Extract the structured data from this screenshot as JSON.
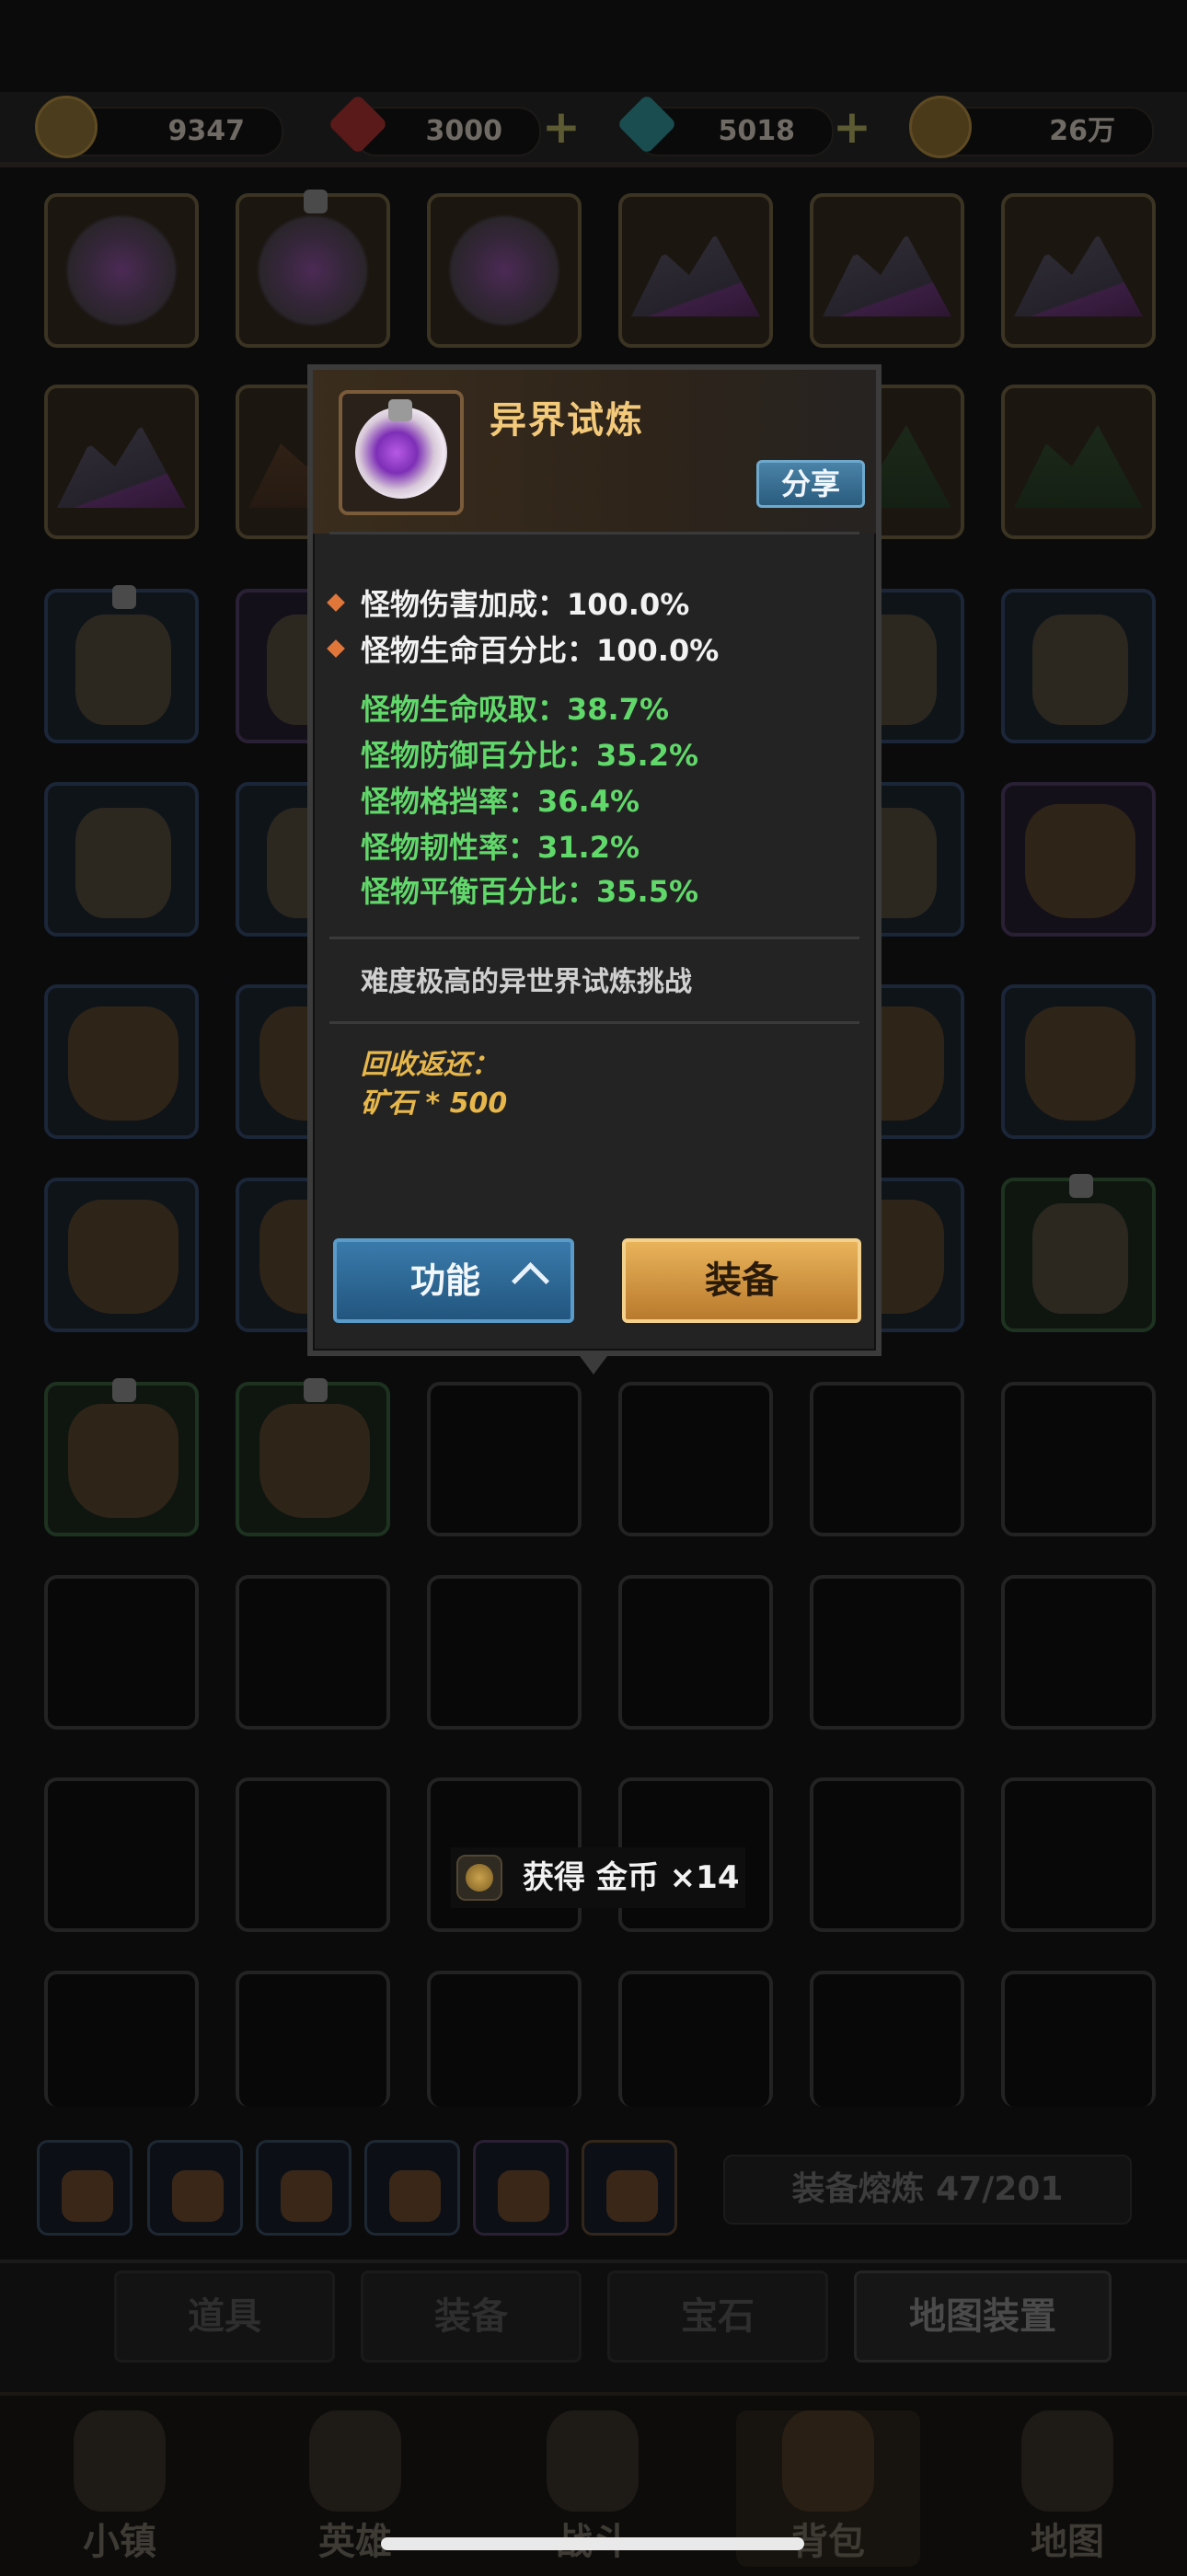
{
  "currencies": [
    {
      "name": "exp-token",
      "value": "9347",
      "color": "#5a4a26"
    },
    {
      "name": "ruby",
      "value": "3000",
      "color": "#6b1d1d"
    },
    {
      "name": "diamond",
      "value": "5018",
      "color": "#1e5a5e"
    },
    {
      "name": "gold-coin",
      "value": "26万",
      "color": "#5a4620"
    }
  ],
  "popup": {
    "title": "异界试炼",
    "share_label": "分享",
    "main_stats": [
      "怪物伤害加成：100.0%",
      "怪物生命百分比：100.0%"
    ],
    "sub_stats": [
      "怪物生命吸取：38.7%",
      "怪物防御百分比：35.2%",
      "怪物格挡率：36.4%",
      "怪物韧性率：31.2%",
      "怪物平衡百分比：35.5%"
    ],
    "description": "难度极高的异世界试炼挑战",
    "recycle_title": "回收返还：",
    "recycle_item": "矿石 * 500",
    "function_label": "功能",
    "equip_label": "装备"
  },
  "toast": {
    "text": "获得 金币 ×14"
  },
  "smelt": {
    "label": "装备熔炼 47/201"
  },
  "category_tabs": [
    "道具",
    "装备",
    "宝石",
    "地图装置"
  ],
  "active_category": "地图装置",
  "nav": [
    "小镇",
    "英雄",
    "战斗",
    "背包",
    "地图"
  ],
  "active_nav": "背包",
  "colors": {
    "title": "#f3c97a",
    "sub_stat": "#61d86a",
    "recycle": "#e7b74b"
  }
}
